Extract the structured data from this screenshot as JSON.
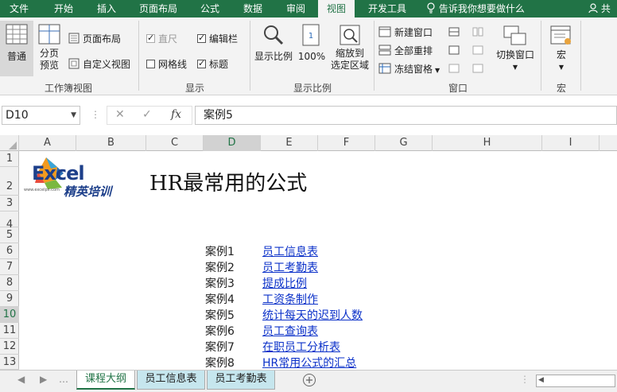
{
  "ribbon_tabs": [
    "文件",
    "开始",
    "插入",
    "页面布局",
    "公式",
    "数据",
    "审阅",
    "视图",
    "开发工具"
  ],
  "active_tab": "视图",
  "tell_me": "告诉我你想要做什么",
  "share": "共",
  "groups": {
    "workbook_views": {
      "label": "工作簿视图",
      "normal": "普通",
      "page_break": "分页\n预览",
      "page_layout": "页面布局",
      "custom_views": "自定义视图"
    },
    "show": {
      "label": "显示",
      "ruler": "直尺",
      "formula_bar": "编辑栏",
      "gridlines": "网格线",
      "headings": "标题"
    },
    "zoom": {
      "label": "显示比例",
      "zoom": "显示比例",
      "hundred": "100%",
      "zoom_selection": "缩放到\n选定区域"
    },
    "window": {
      "label": "窗口",
      "new_window": "新建窗口",
      "arrange_all": "全部重排",
      "freeze_panes": "冻结窗格",
      "switch_windows": "切换窗口"
    },
    "macros": {
      "label": "宏",
      "macros": "宏"
    }
  },
  "name_box": "D10",
  "formula": "案例5",
  "fx": "fx",
  "columns": [
    "A",
    "B",
    "C",
    "D",
    "E",
    "F",
    "G",
    "H",
    "I"
  ],
  "rows": [
    "1",
    "2",
    "3",
    "4",
    "5",
    "6",
    "7",
    "8",
    "9",
    "10",
    "11",
    "12",
    "13"
  ],
  "logo": {
    "text": "Excel",
    "subtitle": "精英培训",
    "url": "www.excelpx.com"
  },
  "sheet_title": "HR最常用的公式",
  "cases": [
    {
      "label": "案例1",
      "link": "员工信息表"
    },
    {
      "label": "案例2",
      "link": "员工考勤表"
    },
    {
      "label": "案例3",
      "link": "提成比例"
    },
    {
      "label": "案例4",
      "link": "工资条制作"
    },
    {
      "label": "案例5",
      "link": "统计每天的迟到人数"
    },
    {
      "label": "案例6",
      "link": "员工查询表"
    },
    {
      "label": "案例7",
      "link": "在职员工分析表"
    },
    {
      "label": "案例8",
      "link": "HR常用公式的汇总"
    }
  ],
  "sheets": [
    "课程大纲",
    "员工信息表",
    "员工考勤表"
  ],
  "active_sheet": "课程大纲",
  "colors": {
    "excel_green": "#217346",
    "link_blue": "#0b31c9",
    "sheet_tab_blue": "#c6e6ee"
  }
}
